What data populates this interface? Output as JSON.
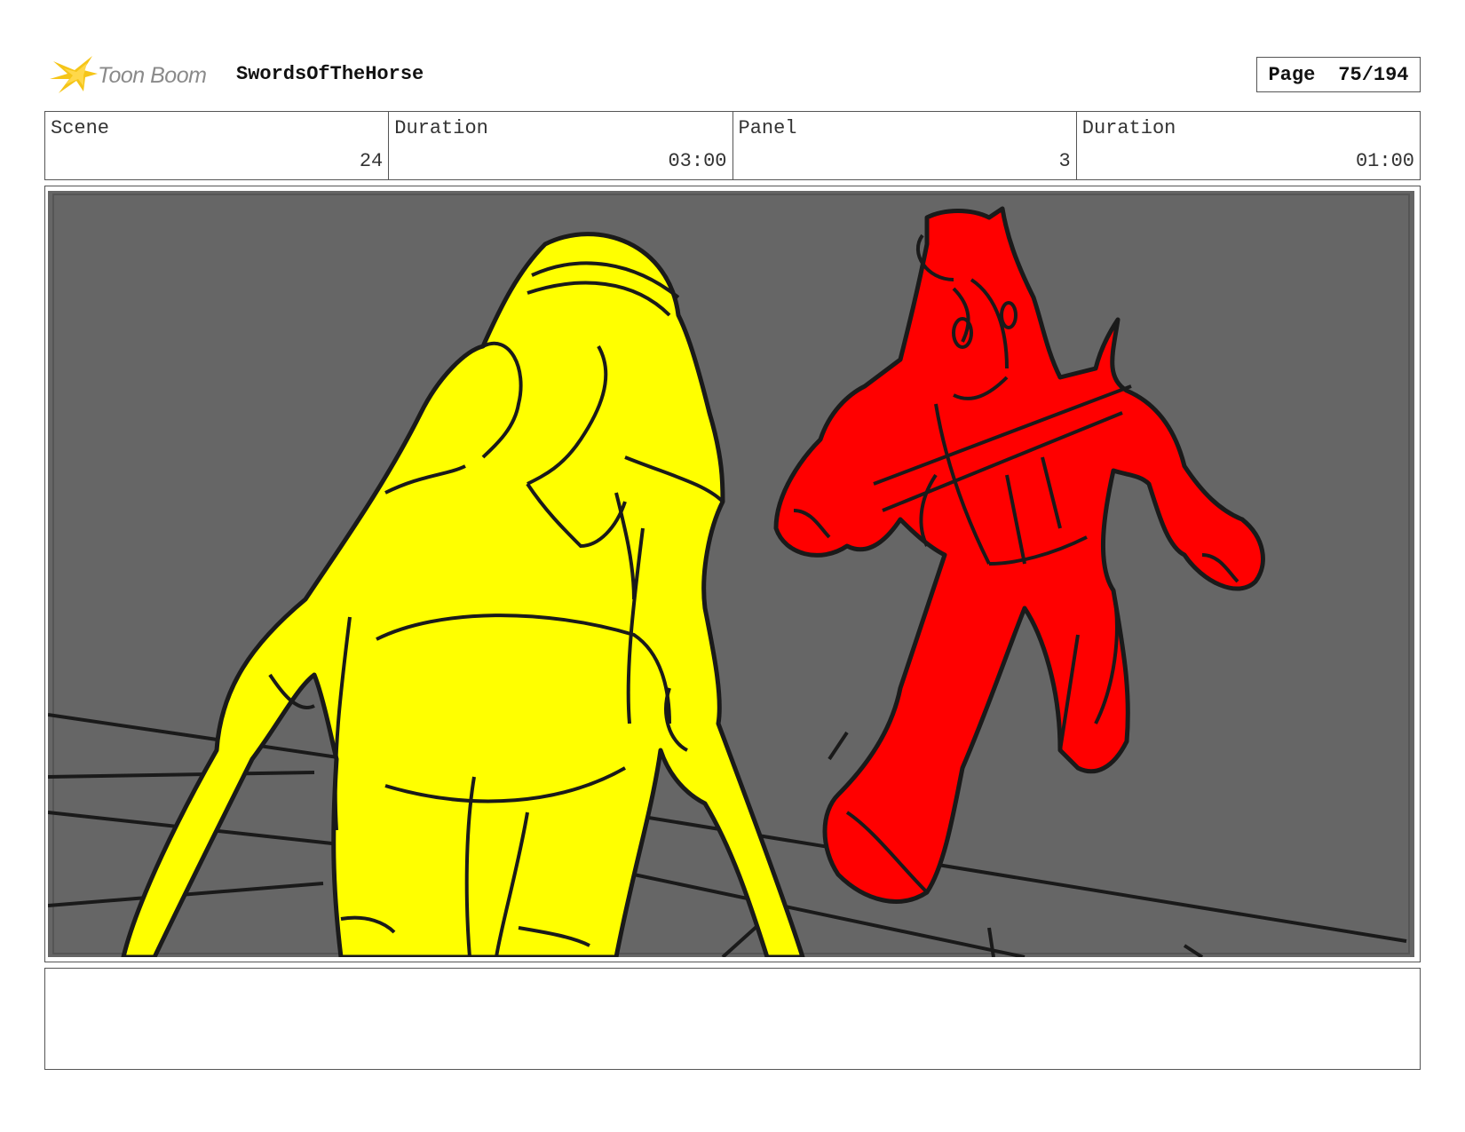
{
  "header": {
    "logo_text": "Toon Boom",
    "project_title": "SwordsOfTheHorse",
    "page_label": "Page",
    "page_value": "75/194"
  },
  "info": {
    "scene_label": "Scene",
    "scene_value": "24",
    "scene_duration_label": "Duration",
    "scene_duration_value": "03:00",
    "panel_label": "Panel",
    "panel_value": "3",
    "panel_duration_label": "Duration",
    "panel_duration_value": "01:00"
  },
  "colors": {
    "logo_accent": "#f5c518",
    "background_gray": "#666666",
    "yellow_character": "#ffff00",
    "red_character": "#ff0000",
    "line_black": "#1a1a1a"
  },
  "notes": {
    "text": ""
  }
}
